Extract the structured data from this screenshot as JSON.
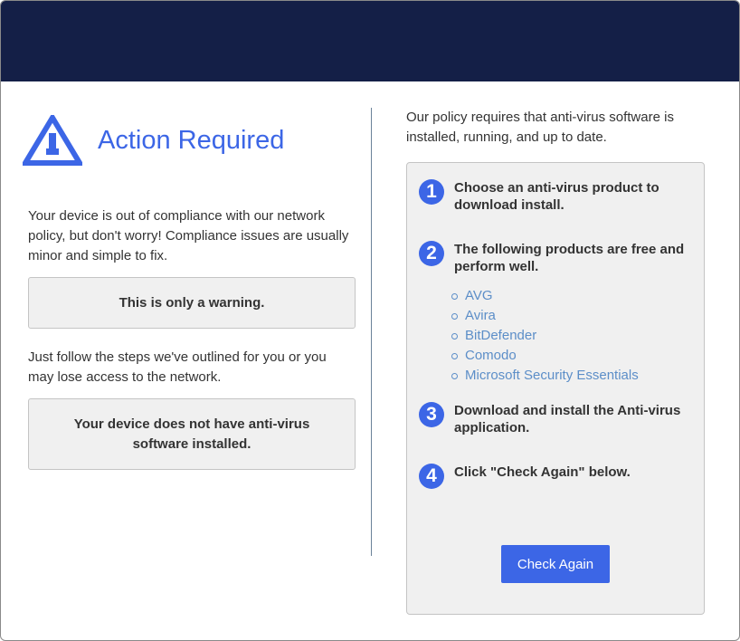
{
  "colors": {
    "top_bar": "#141f47",
    "accent": "#3c66e6",
    "link": "#5c8ec8",
    "panel_bg": "#f0f0f0"
  },
  "header": {
    "icon": "warning-triangle-icon",
    "title": "Action Required"
  },
  "left": {
    "intro": "Your device is out of compliance with our network policy, but don't worry! Compliance issues are usually minor and simple to fix.",
    "warning_box": "This is only a warning.",
    "follow_text": "Just follow the steps we've outlined for you or you may lose access to the network.",
    "status_box": "Your device does not have anti-virus software installed."
  },
  "right": {
    "intro": "Our policy requires that anti-virus software is installed, running, and up to date.",
    "steps": [
      {
        "num": "1",
        "text": "Choose an anti-virus product to download install."
      },
      {
        "num": "2",
        "text": "The following products are free and perform well."
      },
      {
        "num": "3",
        "text": "Download and install the Anti-virus application."
      },
      {
        "num": "4",
        "text": "Click \"Check Again\" below."
      }
    ],
    "products": [
      "AVG",
      "Avira",
      "BitDefender",
      "Comodo",
      "Microsoft Security Essentials"
    ],
    "check_button": "Check Again"
  }
}
